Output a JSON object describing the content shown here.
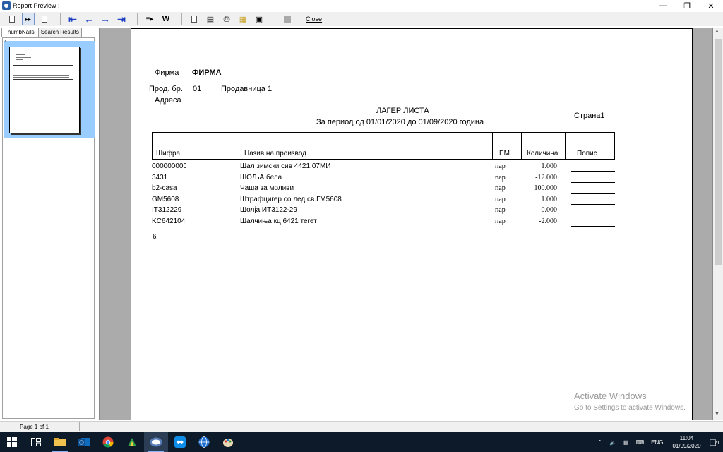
{
  "window": {
    "title": "Report Preview :"
  },
  "toolbar": {
    "close_label": "Close"
  },
  "left_panel": {
    "tabs": [
      "ThumbNails",
      "Search Results"
    ],
    "thumbnail_number": "1"
  },
  "report": {
    "firm_label": "Фирма",
    "firm_value": "ФИРМА",
    "store_label": "Прод. бр.",
    "store_number": "01",
    "store_name": "Продавница 1",
    "address_label": "Адреса",
    "title": "ЛАГЕР ЛИСТА",
    "period": "За период од 01/01/2020 до 01/09/2020 година",
    "page_label": "Страна1",
    "columns": [
      "Шифра",
      "Назив на производ",
      "ЕМ",
      "Количина",
      "Попис"
    ],
    "rows": [
      {
        "code": "000000000",
        "name": "Шал зимски сив 4421.07МИ",
        "unit": "пар",
        "qty": "1.000"
      },
      {
        "code": "3431",
        "name": "ШОЉА бела",
        "unit": "пар",
        "qty": "-12.000"
      },
      {
        "code": "b2-casa",
        "name": "Чаша за моливи",
        "unit": "пар",
        "qty": "100.000"
      },
      {
        "code": "GM5608",
        "name": "Штрафцигер со лед св.ГМ5608",
        "unit": "пар",
        "qty": "1.000"
      },
      {
        "code": "IT312229",
        "name": "Шолја ИТ3122-29",
        "unit": "пар",
        "qty": "0.000"
      },
      {
        "code": "KC642104",
        "name": "Шалчињa кц 6421 тегет",
        "unit": "пар",
        "qty": "-2.000"
      }
    ],
    "total_count": "6"
  },
  "watermark": {
    "line1": "Activate Windows",
    "line2": "Go to Settings to activate Windows."
  },
  "status": {
    "page_text": "Page 1 of 1"
  },
  "taskbar": {
    "lang": "ENG",
    "time": "11:04",
    "date": "01/09/2020",
    "notif_count": "21"
  }
}
